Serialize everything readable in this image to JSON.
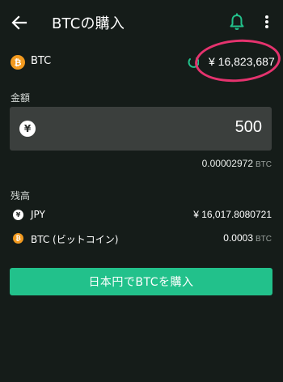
{
  "header": {
    "title": "BTCの購入",
    "icons": {
      "back": "arrow-left-icon",
      "notification": "bell-icon",
      "menu": "more-vert-icon"
    }
  },
  "coin": {
    "symbol_glyph": "₿",
    "name": "BTC",
    "price": "¥ 16,823,687"
  },
  "amount": {
    "label": "金額",
    "currency_glyph": "¥",
    "value": "500",
    "converted_value": "0.00002972",
    "converted_unit": "BTC"
  },
  "balance": {
    "label": "残高",
    "items": [
      {
        "name": "JPY",
        "value": "¥ 16,017.8080721",
        "unit": ""
      },
      {
        "name": "BTC (ビットコイン)",
        "value": "0.0003",
        "unit": "BTC"
      }
    ]
  },
  "buy_button": {
    "label": "日本円でBTCを購入"
  },
  "colors": {
    "background": "#151c19",
    "accent_green": "#22c18b",
    "btc_orange": "#f29a1f",
    "highlight_pink": "#e5336e",
    "input_background": "#3b3f3d"
  }
}
